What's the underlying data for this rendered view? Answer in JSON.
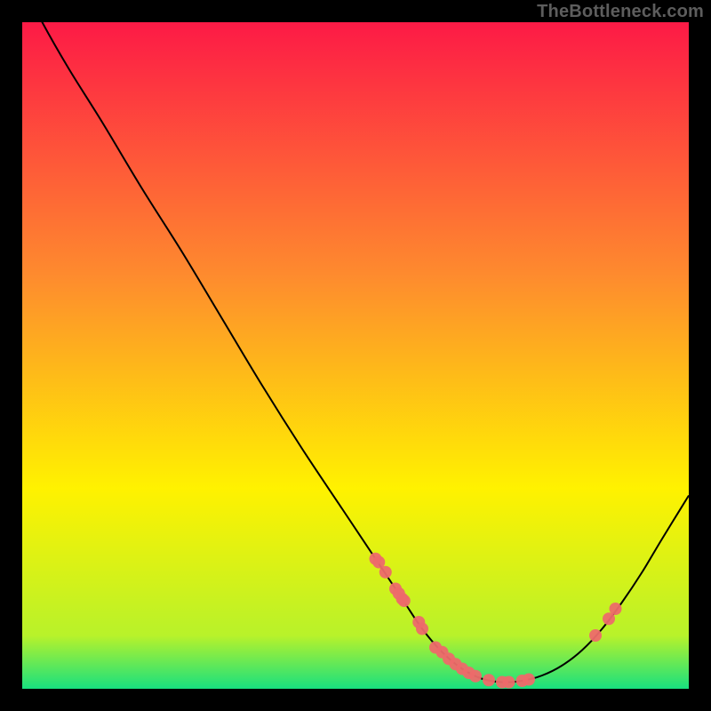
{
  "watermark": "TheBottleneck.com",
  "chart_data": {
    "type": "line",
    "title": "",
    "xlabel": "",
    "ylabel": "",
    "xlim": [
      0,
      100
    ],
    "ylim": [
      0,
      100
    ],
    "grid": false,
    "legend": false,
    "background_gradient": {
      "top": "#fd1a46",
      "mid_upper": "#fe8b2e",
      "mid": "#fff200",
      "lower": "#b8f22a",
      "bottom": "#18e07f"
    },
    "curve": {
      "x": [
        0,
        3,
        7,
        12,
        18,
        24,
        30,
        36,
        42,
        48,
        53,
        57,
        60,
        63,
        66,
        69,
        72,
        75,
        78,
        81,
        84,
        87,
        90,
        93,
        96,
        100
      ],
      "y": [
        106,
        100,
        93,
        85,
        75,
        65.5,
        55.5,
        45.5,
        36,
        27,
        19.5,
        13.5,
        9,
        5.5,
        3,
        1.5,
        1,
        1.2,
        2,
        3.5,
        5.8,
        9,
        13,
        17.5,
        22.5,
        29
      ]
    },
    "markers": {
      "x": [
        53,
        53.5,
        54.5,
        56,
        56.5,
        57,
        57.3,
        59.5,
        60,
        62,
        63,
        64,
        65,
        66,
        67,
        68,
        70,
        72,
        73,
        75,
        76,
        86,
        88,
        89
      ],
      "y": [
        19.5,
        19,
        17.5,
        15,
        14.3,
        13.5,
        13.2,
        10,
        9,
        6.2,
        5.5,
        4.5,
        3.7,
        3,
        2.4,
        1.9,
        1.3,
        1,
        1,
        1.2,
        1.4,
        8,
        10.5,
        12
      ]
    },
    "marker_style": {
      "color": "#ed6a6a",
      "radius": 7
    }
  }
}
